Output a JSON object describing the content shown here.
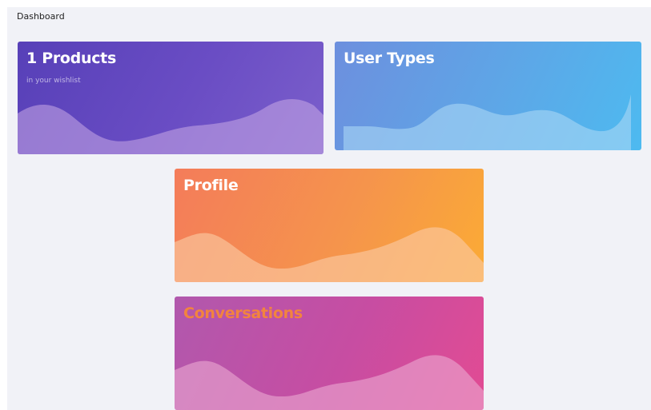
{
  "breadcrumb": {
    "label": "Dashboard"
  },
  "cards": {
    "products": {
      "title": "1 Products",
      "subtitle": "in your wishlist"
    },
    "user_types": {
      "title": "User Types"
    },
    "profile": {
      "title": "Profile"
    },
    "conversations": {
      "title": "Conversations"
    }
  },
  "colors": {
    "page_background": "#f1f2f7",
    "products_gradient": [
      "#5740b8",
      "#7b5fcb"
    ],
    "user_types_gradient": [
      "#6d8fde",
      "#4dbaf0"
    ],
    "profile_gradient": [
      "#f47c5a",
      "#fbab35"
    ],
    "conversations_gradient": [
      "#b158ad",
      "#e24b93"
    ],
    "conversations_title": "#f2843e"
  }
}
